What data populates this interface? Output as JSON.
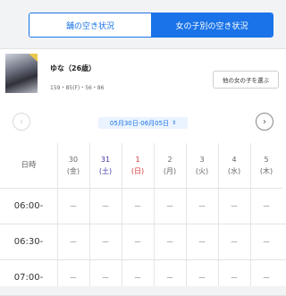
{
  "tabs": {
    "shop": "舗の空き状況",
    "girl": "女の子別の空き状況"
  },
  "profile": {
    "name": "ゆな（26歳）",
    "measurements": "159・85(F)・56・86",
    "other_button": "他の女の子を選ぶ"
  },
  "week_nav": {
    "prev_icon": "chevron-left-icon",
    "next_icon": "chevron-right-icon",
    "range": "05月30日-06月05日",
    "sort_icon": "⇕"
  },
  "schedule": {
    "time_header": "日時",
    "days": [
      {
        "date": "30",
        "weekday": "(金)",
        "color": "#666666"
      },
      {
        "date": "31",
        "weekday": "(土)",
        "color": "#3d3aa6"
      },
      {
        "date": "1",
        "weekday": "(日)",
        "color": "#d43434"
      },
      {
        "date": "2",
        "weekday": "(月)",
        "color": "#666666"
      },
      {
        "date": "3",
        "weekday": "(火)",
        "color": "#666666"
      },
      {
        "date": "4",
        "weekday": "(水)",
        "color": "#666666"
      },
      {
        "date": "5",
        "weekday": "(木)",
        "color": "#666666"
      }
    ],
    "rows": [
      {
        "time": "06:00-",
        "cells": [
          "－",
          "－",
          "－",
          "－",
          "－",
          "－",
          "－"
        ]
      },
      {
        "time": "06:30-",
        "cells": [
          "－",
          "－",
          "－",
          "－",
          "－",
          "－",
          "－"
        ]
      },
      {
        "time": "07:00-",
        "cells": [
          "－",
          "－",
          "－",
          "－",
          "－",
          "－",
          "－"
        ]
      }
    ]
  }
}
